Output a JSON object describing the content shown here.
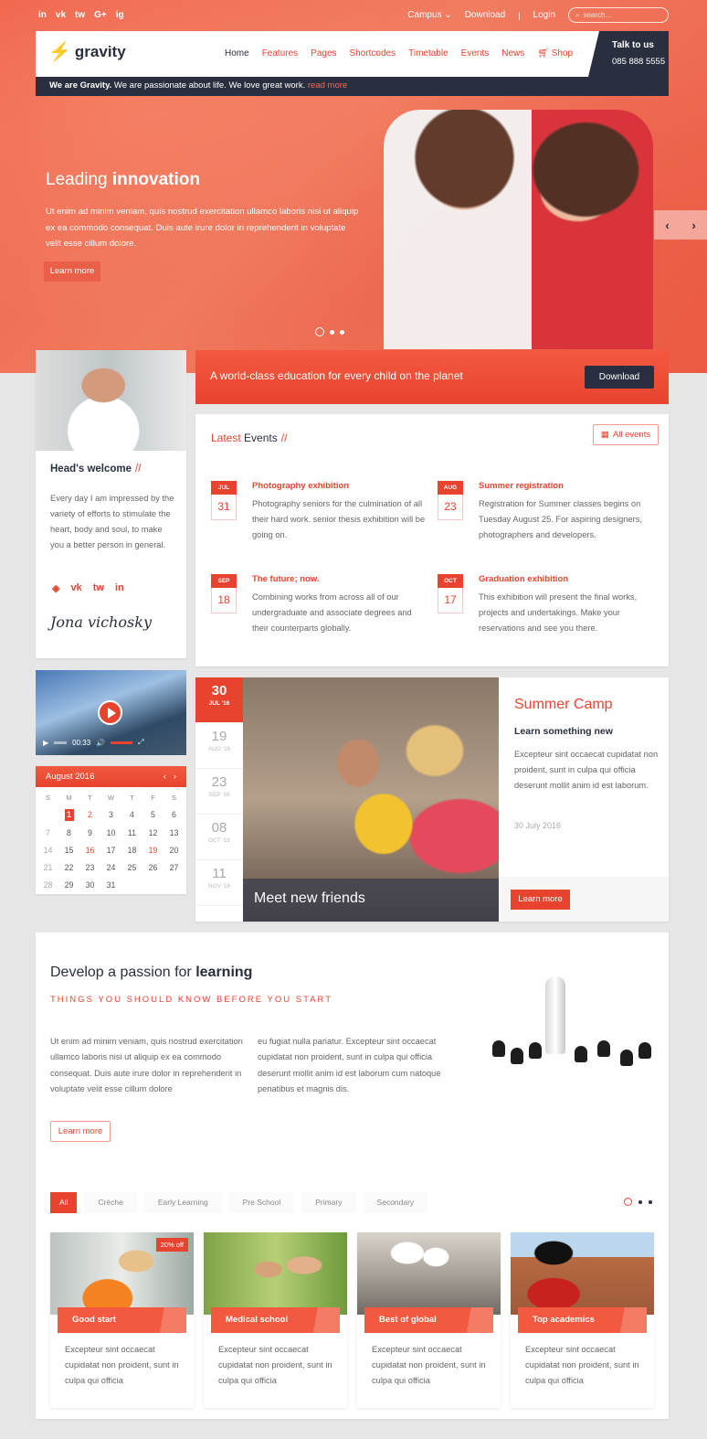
{
  "topbar": {
    "social": [
      "in",
      "vk",
      "tw",
      "G+",
      "ig"
    ],
    "links": [
      "Campus",
      "Download",
      "Login"
    ],
    "campus_caret": "⌄",
    "separator": "|",
    "search_placeholder": "search..."
  },
  "header": {
    "logo": "gravity",
    "nav": [
      "Home",
      "Features",
      "Pages",
      "Shortcodes",
      "Timetable",
      "Events",
      "News",
      "Shop"
    ],
    "contact_label": "Talk to us",
    "contact_phone": "085 888 5555",
    "tagline_bold": "We are Gravity.",
    "tagline": " We are passionate about life. We love great work. ",
    "tagline_link": "read more"
  },
  "hero": {
    "title_light": "Leading ",
    "title_bold": "innovation",
    "text": "Ut enim ad minim veniam, quis nostrud exercitation ullamco laboris nisi ut aliquip ex ea commodo consequat. Duis aute irure dolor in reprehenderit in voluptate velit esse cillum dolore.",
    "button": "Learn more",
    "prev": "‹",
    "next": "›",
    "slides": 3,
    "active_slide": 1
  },
  "head_welcome": {
    "title": "Head's welcome",
    "slash": "//",
    "text": "Every day I am impressed by the variety of efforts to stimulate the heart, body and soul, to make you a better person in general.",
    "social": [
      "◈",
      "vk",
      "tw",
      "in"
    ],
    "signature": "Jona vichosky"
  },
  "cta": {
    "text": "A world-class education for every child on the planet",
    "button": "Download"
  },
  "events": {
    "title_red": "Latest",
    "title_dark": " Events",
    "slash": "//",
    "all_button": "All events",
    "items": [
      {
        "month": "JUL",
        "day": "31",
        "title": "Photography exhibition",
        "text": "Photography seniors for the culmination of all their hard work. senior thesis exhibition will be going on."
      },
      {
        "month": "AUG",
        "day": "23",
        "title": "Summer registration",
        "text": "Registration for Summer classes begins on Tuesday August 25. For aspiring designers, photographers and developers."
      },
      {
        "month": "SEP",
        "day": "18",
        "title": "The future; now.",
        "text": "Combining works from across all of our undergraduate and associate degrees and their counterparts globally."
      },
      {
        "month": "OCT",
        "day": "17",
        "title": "Graduation exhibition",
        "text": "This exhibition will present the final works, projects and undertakings. Make your reservations and see you there."
      }
    ]
  },
  "video": {
    "time": "00:33",
    "play": "▶",
    "volume": "🔊",
    "fullscreen": "⤢"
  },
  "calendar": {
    "month": "August 2016",
    "prev": "‹",
    "next": "›",
    "weekdays": [
      "S",
      "M",
      "T",
      "W",
      "T",
      "F",
      "S"
    ],
    "days": [
      "",
      "1",
      "2",
      "3",
      "4",
      "5",
      "6",
      "7",
      "8",
      "9",
      "10",
      "11",
      "12",
      "13",
      "14",
      "15",
      "16",
      "17",
      "18",
      "19",
      "20",
      "21",
      "22",
      "23",
      "24",
      "25",
      "26",
      "27",
      "28",
      "29",
      "30",
      "31",
      "",
      "",
      ""
    ],
    "selected": "1",
    "highlighted": [
      "2",
      "16",
      "19"
    ]
  },
  "camp": {
    "dates": [
      {
        "n": "30",
        "s": "JUL '16",
        "active": true
      },
      {
        "n": "19",
        "s": "AUG '16"
      },
      {
        "n": "23",
        "s": "SEP '16"
      },
      {
        "n": "08",
        "s": "OCT '16"
      },
      {
        "n": "11",
        "s": "NOV '16"
      }
    ],
    "caption": "Meet new friends",
    "title": "Summer Camp",
    "subtitle": "Learn something new",
    "text": "Excepteur sint occaecat cupidatat non proident, sunt in culpa qui officia deserunt mollit anim id est laborum.",
    "date": "30 July 2016",
    "button": "Learn more"
  },
  "passion": {
    "title_light": "Develop a passion for ",
    "title_bold": "learning",
    "subtitle": "THINGS YOU SHOULD KNOW BEFORE YOU START",
    "col1": "Ut enim ad minim veniam, quis nostrud exercitation ullamco laboris nisi ut aliquip ex ea commodo consequat. Duis aute irure dolor in reprehenderit in voluptate velit esse cillum dolore",
    "col2": "eu fugiat nulla pariatur. Excepteur sint occaecat cupidatat non proident, sunt in culpa qui officia deserunt mollit anim id est laborum cum natoque penatibus et magnis dis.",
    "button": "Learn more",
    "filters": [
      "All",
      "Crèche",
      "Early Learning",
      "Pre School",
      "Primary",
      "Secondary"
    ],
    "active_filter": "All",
    "pages": 3,
    "programs": [
      {
        "title": "Good start",
        "badge": "20% off",
        "text": "Excepteur sint occaecat cupidatat non proident, sunt in culpa qui officia"
      },
      {
        "title": "Medical school",
        "text": "Excepteur sint occaecat cupidatat non proident, sunt in culpa qui officia"
      },
      {
        "title": "Best of global",
        "text": "Excepteur sint occaecat cupidatat non proident, sunt in culpa qui officia"
      },
      {
        "title": "Top academics",
        "text": "Excepteur sint occaecat cupidatat non proident, sunt in culpa qui officia"
      }
    ]
  },
  "colors": {
    "accent": "#e8432f",
    "dark": "#2a2f3f",
    "background": "#e6e6e6"
  }
}
